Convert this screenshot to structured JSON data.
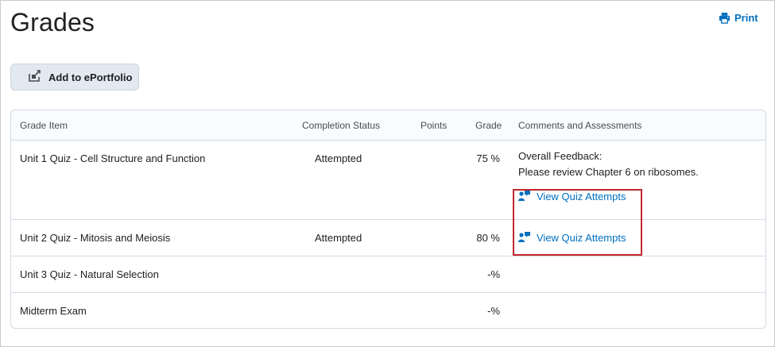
{
  "page": {
    "title": "Grades",
    "print_label": "Print",
    "add_eportfolio_label": "Add to ePortfolio"
  },
  "table": {
    "headers": {
      "grade_item": "Grade Item",
      "completion_status": "Completion Status",
      "points": "Points",
      "grade": "Grade",
      "comments": "Comments and Assessments"
    },
    "rows": [
      {
        "item": "Unit 1 Quiz - Cell Structure and Function",
        "status": "Attempted",
        "points": "",
        "grade": "75 %",
        "feedback_label": "Overall Feedback:",
        "feedback_text": "Please review Chapter 6 on ribosomes.",
        "link": "View Quiz Attempts"
      },
      {
        "item": "Unit 2 Quiz - Mitosis and Meiosis",
        "status": "Attempted",
        "points": "",
        "grade": "80 %",
        "link": "View Quiz Attempts"
      },
      {
        "item": "Unit 3 Quiz - Natural Selection",
        "status": "",
        "points": "",
        "grade": "-%"
      },
      {
        "item": "Midterm Exam",
        "status": "",
        "points": "",
        "grade": "-%"
      }
    ]
  },
  "colors": {
    "link": "#006fbf",
    "highlight": "#c1272d",
    "button_bg": "#e3e9f1"
  },
  "icons": [
    "printer-icon",
    "portfolio-add-icon",
    "quiz-attempts-icon"
  ]
}
